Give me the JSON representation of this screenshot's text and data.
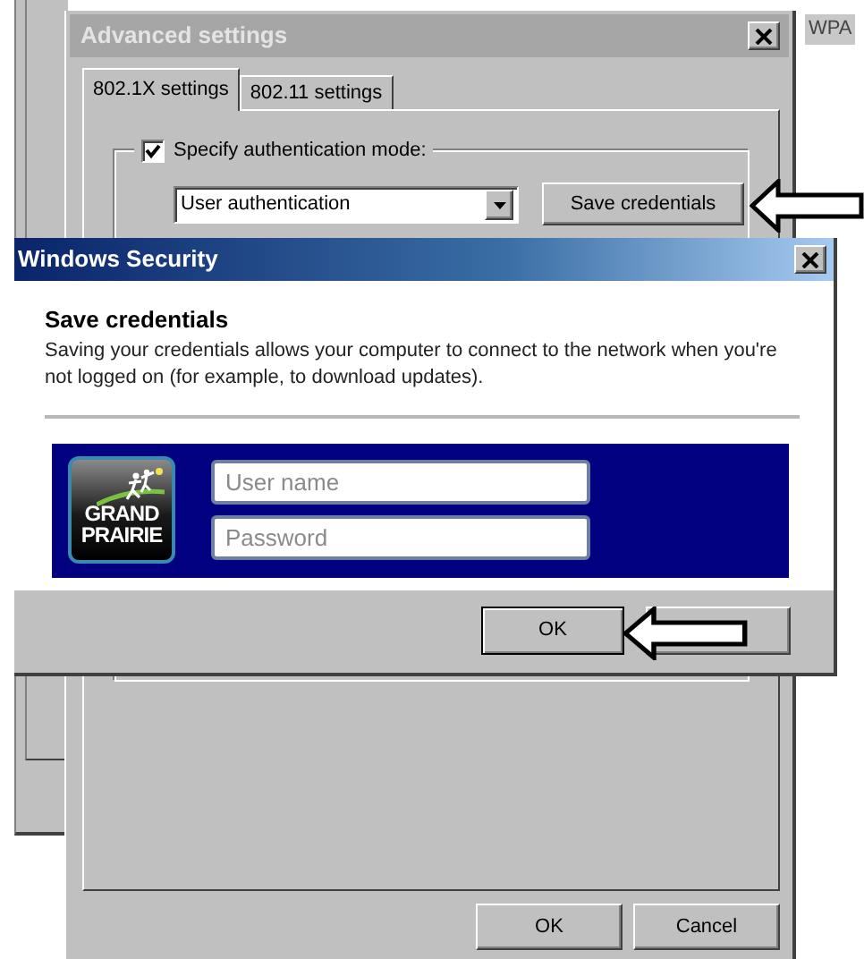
{
  "background_window": {
    "label": "WPA"
  },
  "advanced_settings": {
    "title": "Advanced settings",
    "tabs": [
      {
        "label": "802.1X settings",
        "selected": true
      },
      {
        "label": "802.11 settings",
        "selected": false
      }
    ],
    "auth_mode": {
      "label": "Specify authentication mode:",
      "checked": true
    },
    "dropdown": {
      "value": "User authentication"
    },
    "save_button": "Save credentials",
    "buttons": [
      "OK",
      "Cancel"
    ]
  },
  "security_dialog": {
    "title": "Windows Security",
    "heading": "Save credentials",
    "description": "Saving your credentials allows your computer to connect to the network when you're not logged on (for example, to download updates).",
    "logo": [
      "GRAND",
      "PRAIRIE"
    ],
    "fields": [
      {
        "placeholder": "User name"
      },
      {
        "placeholder": "Password"
      }
    ],
    "ok_button": "OK"
  }
}
